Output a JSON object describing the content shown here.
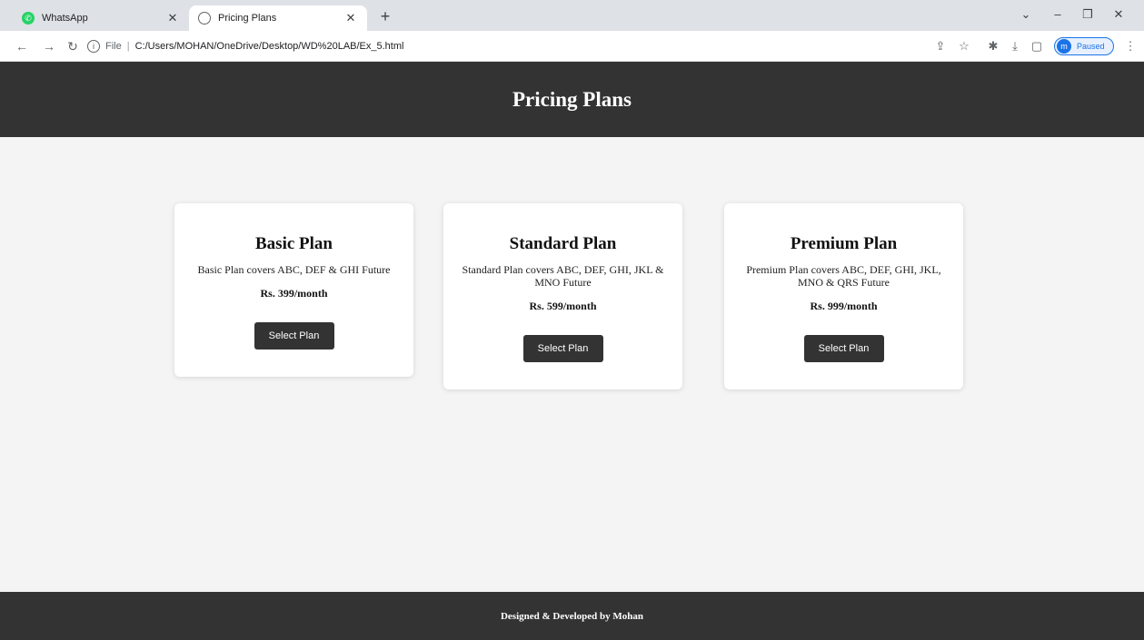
{
  "browser": {
    "tabs": [
      {
        "title": "WhatsApp",
        "active": false
      },
      {
        "title": "Pricing Plans",
        "active": true
      }
    ],
    "new_tab": "+",
    "address": {
      "scheme": "File",
      "url": "C:/Users/MOHAN/OneDrive/Desktop/WD%20LAB/Ex_5.html"
    },
    "profile": {
      "initial": "m",
      "status": "Paused"
    }
  },
  "page": {
    "header_title": "Pricing Plans",
    "plans": [
      {
        "name": "Basic Plan",
        "description": "Basic Plan covers ABC, DEF & GHI Future",
        "price": "Rs. 399/month",
        "button": "Select Plan"
      },
      {
        "name": "Standard Plan",
        "description": "Standard Plan covers ABC, DEF, GHI, JKL & MNO Future",
        "price": "Rs. 599/month",
        "button": "Select Plan"
      },
      {
        "name": "Premium Plan",
        "description": "Premium Plan covers ABC, DEF, GHI, JKL, MNO & QRS Future",
        "price": "Rs. 999/month",
        "button": "Select Plan"
      }
    ],
    "footer_text": "Designed & Developed by Mohan"
  },
  "colors": {
    "header_bg": "#333333",
    "page_bg": "#f4f4f4",
    "card_bg": "#ffffff",
    "button_bg": "#333333",
    "accent": "#1a73e8"
  }
}
